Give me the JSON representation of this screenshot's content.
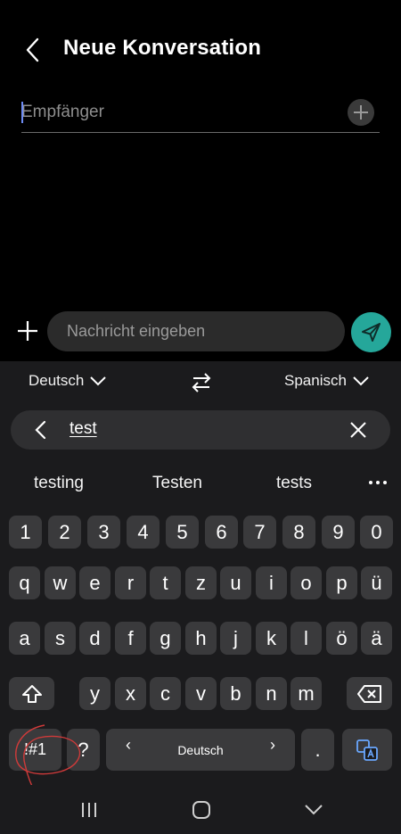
{
  "header": {
    "title": "Neue Konversation",
    "back_icon": "back-arrow-icon"
  },
  "recipient": {
    "placeholder": "Empfänger",
    "add_icon": "plus-icon"
  },
  "compose": {
    "placeholder": "Nachricht eingeben",
    "send_color": "#25a79a"
  },
  "keyboard": {
    "translate": {
      "source_language": "Deutsch",
      "target_language": "Spanisch"
    },
    "search": {
      "text": "test"
    },
    "suggestions": [
      "testing",
      "Testen",
      "tests"
    ],
    "rows": {
      "numbers": [
        "1",
        "2",
        "3",
        "4",
        "5",
        "6",
        "7",
        "8",
        "9",
        "0"
      ],
      "row1": [
        "q",
        "w",
        "e",
        "r",
        "t",
        "z",
        "u",
        "i",
        "o",
        "p",
        "ü"
      ],
      "row2": [
        "a",
        "s",
        "d",
        "f",
        "g",
        "h",
        "j",
        "k",
        "l",
        "ö",
        "ä"
      ],
      "row3": [
        "y",
        "x",
        "c",
        "v",
        "b",
        "n",
        "m"
      ]
    },
    "bottom": {
      "symbols_key": "!#1",
      "question_key": "?",
      "space_label": "Deutsch",
      "period_key": "."
    }
  },
  "navbar": {
    "recents_icon": "recents-icon",
    "home_icon": "home-icon",
    "back_icon": "nav-back-icon"
  }
}
